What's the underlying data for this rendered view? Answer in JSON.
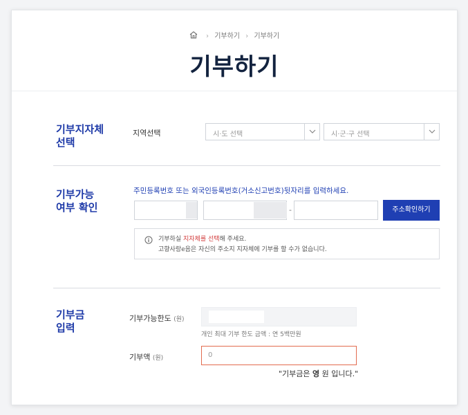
{
  "breadcrumb": {
    "items": [
      "기부하기",
      "기부하기"
    ]
  },
  "page_title": "기부하기",
  "region_section": {
    "title_line1": "기부지자체",
    "title_line2": "선택",
    "label": "지역선택",
    "select_province": "시·도 선택",
    "select_district": "시·군·구 선택"
  },
  "eligibility_section": {
    "title_line1": "기부가능",
    "title_line2": "여부 확인",
    "instruction": "주민등록번호 또는 외국인등록번호(거소신고번호)뒷자리를 입력하세요.",
    "dash": "-",
    "address_button": "주소확인하기",
    "notice_line1_pre": "기부하실 ",
    "notice_line1_highlight": "지자체를 선택",
    "notice_line1_post": "해 주세요.",
    "notice_line2": "고향사랑e음은 자신의 주소지 지자체에 기부를 할 수가 없습니다."
  },
  "amount_section": {
    "title_line1": "기부금",
    "title_line2": "입력",
    "limit_label": "기부가능한도",
    "limit_unit": "(원)",
    "limit_note": "개인 최대 기부 한도 금액 : 연 5백만원",
    "amount_label": "기부액",
    "amount_unit": "(원)",
    "amount_value": "0",
    "result_pre": "\"기부금은 ",
    "result_value": "영",
    "result_post": " 원 입니다.\""
  },
  "colors": {
    "accent": "#1f3fb3",
    "title": "#13233f",
    "error_border": "#e26a4e",
    "highlight": "#d23b3b"
  }
}
